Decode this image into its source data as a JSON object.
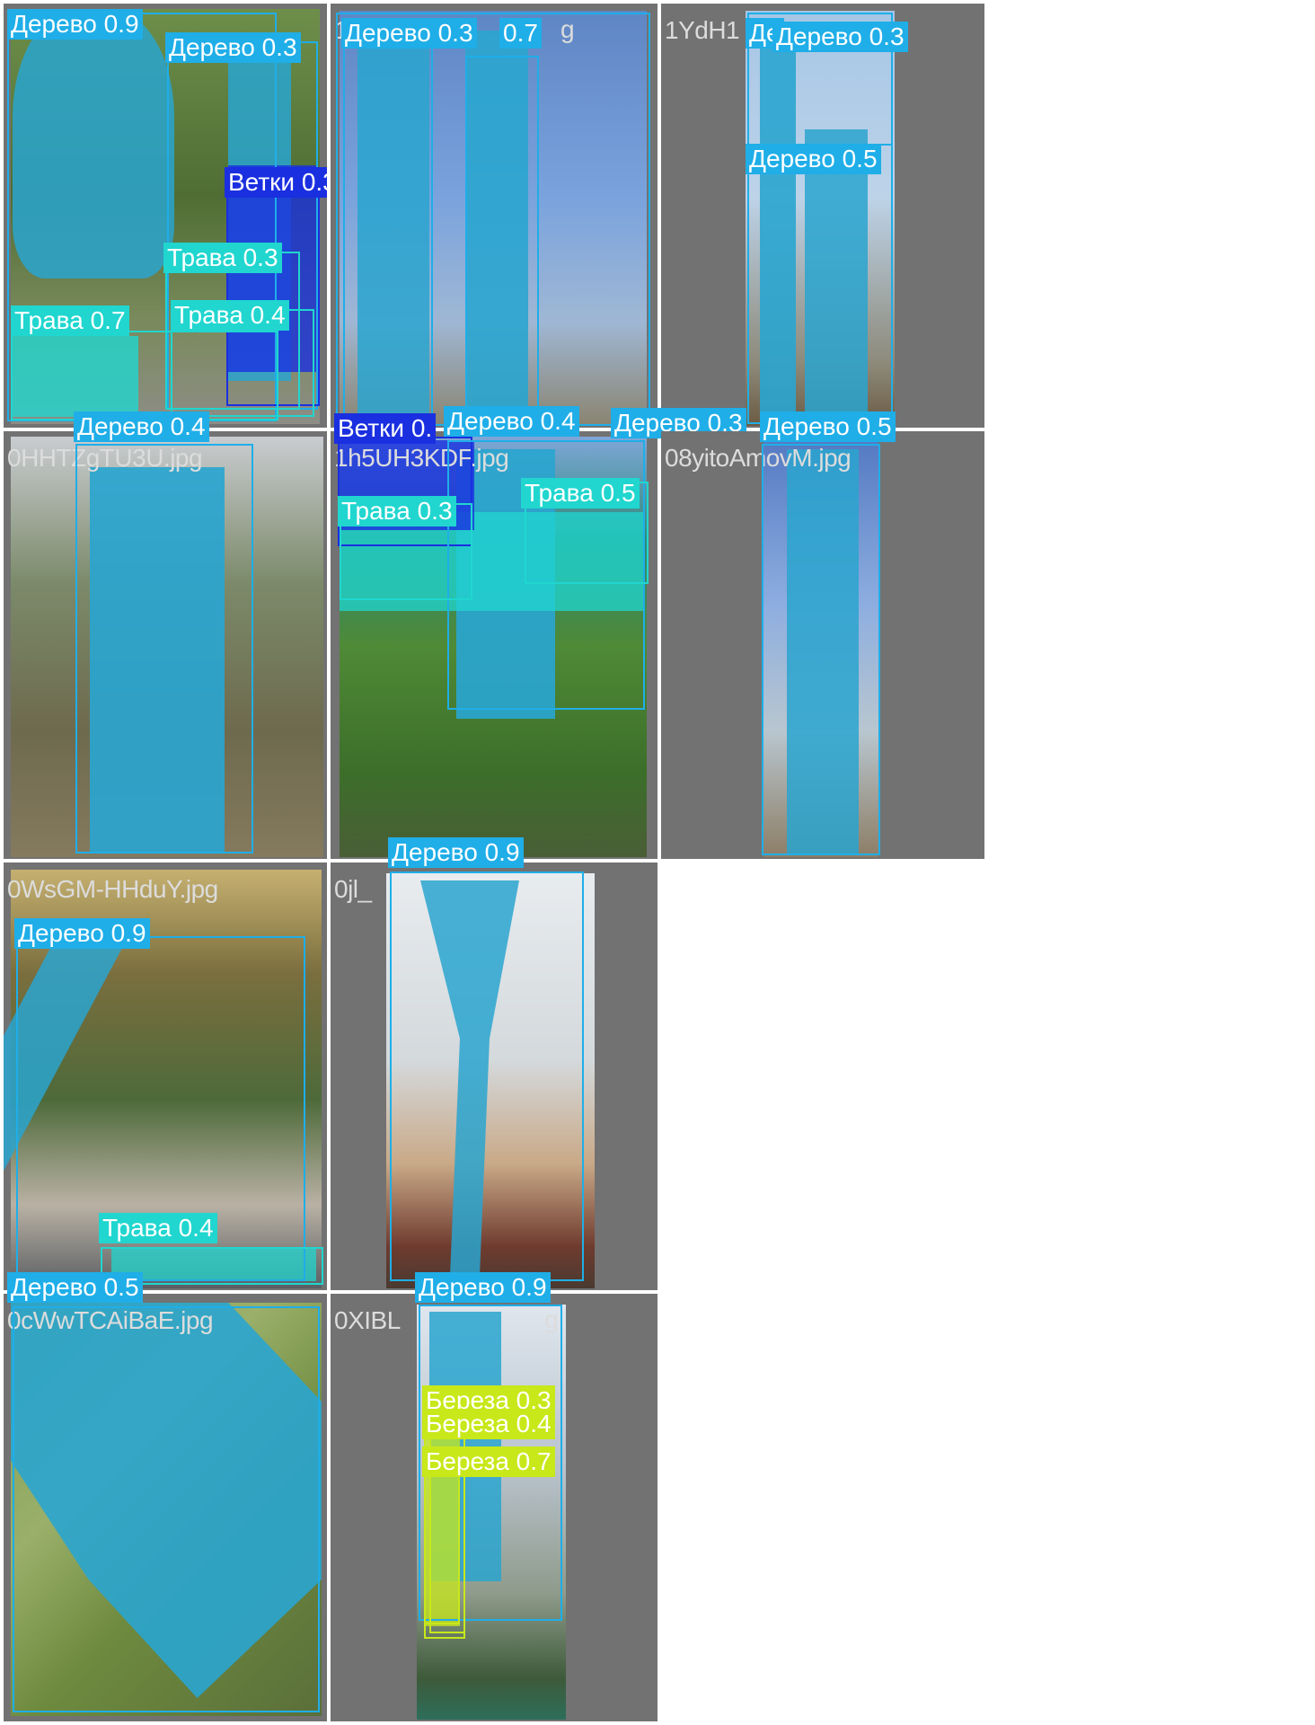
{
  "colors": {
    "tile_bg": "#727272",
    "filename_text": "#dcdcdc",
    "tree": "#1faee8",
    "branches": "#1a2fe0",
    "grass": "#20d6cf",
    "birch": "#c8e81a",
    "label_text": "#ffffff"
  },
  "tiles": [
    {
      "filename": "0",
      "detections": [
        {
          "label": "Дерево 0.9",
          "cls": "tree"
        },
        {
          "label": "Дерево 0.3",
          "cls": "tree"
        },
        {
          "label": "Ветки 0.3",
          "cls": "branches"
        },
        {
          "label": "Трава 0.3",
          "cls": "grass"
        },
        {
          "label": "Трава 0.4",
          "cls": "grass"
        },
        {
          "label": "Трава 0.7",
          "cls": "grass"
        }
      ]
    },
    {
      "filename": "1",
      "detections": [
        {
          "label": "Дерево 0.3",
          "cls": "tree"
        },
        {
          "label": "0.7",
          "cls": "tree"
        },
        {
          "label": "Ветки 0.",
          "cls": "branches"
        },
        {
          "label": "Дерево 0.4",
          "cls": "tree"
        },
        {
          "label": "Дерево 0.3",
          "cls": "tree"
        }
      ],
      "filename_tail": "g"
    },
    {
      "filename": "1YdH1",
      "detections": [
        {
          "label": "Дерево 0.3",
          "cls": "tree"
        },
        {
          "label": "Дерево 0.5",
          "cls": "tree"
        },
        {
          "label": "Де",
          "cls": "tree"
        }
      ]
    },
    {
      "filename": "0HHTZgTU3U.jpg",
      "detections": [
        {
          "label": "Дерево 0.4",
          "cls": "tree"
        }
      ]
    },
    {
      "filename": "1h5UH3KDF.jpg",
      "detections": [
        {
          "label": "Трава 0.3",
          "cls": "grass"
        },
        {
          "label": "Трава 0.5",
          "cls": "grass"
        }
      ]
    },
    {
      "filename": "08yitoAmovM.jpg",
      "detections": [
        {
          "label": "Дерево 0.5",
          "cls": "tree"
        }
      ]
    },
    {
      "filename": "0WsGM-HHduY.jpg",
      "detections": [
        {
          "label": "Дерево 0.9",
          "cls": "tree"
        },
        {
          "label": "Трава 0.4",
          "cls": "grass"
        }
      ]
    },
    {
      "filename": "0jl_",
      "detections": [
        {
          "label": "Дерево 0.9",
          "cls": "tree"
        }
      ]
    },
    {
      "filename": "0cWwTCAiBaE.jpg",
      "detections": [
        {
          "label": "Дерево 0.5",
          "cls": "tree"
        }
      ]
    },
    {
      "filename": "0XIBL",
      "filename_tail": "g",
      "detections": [
        {
          "label": "Дерево 0.9",
          "cls": "tree"
        },
        {
          "label": "Береза 0.3",
          "cls": "birch"
        },
        {
          "label": "Береза 0.4",
          "cls": "birch"
        },
        {
          "label": "Береза 0.7",
          "cls": "birch"
        }
      ]
    }
  ]
}
